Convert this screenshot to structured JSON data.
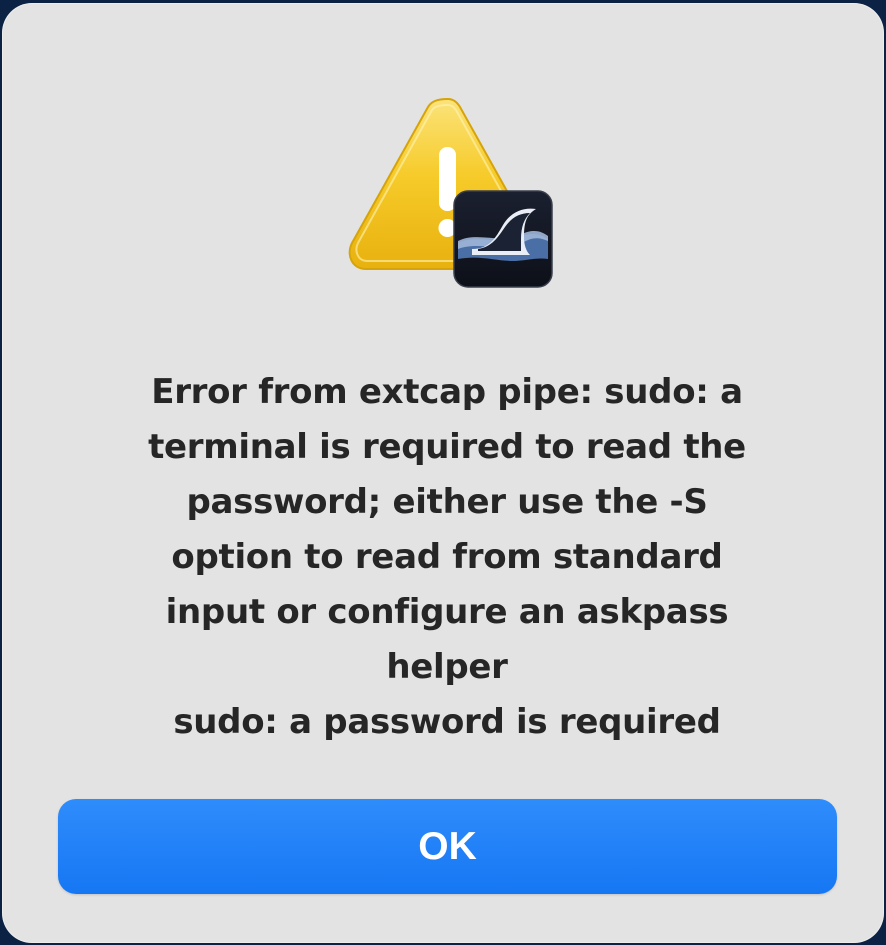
{
  "dialog": {
    "message_lines": [
      "Error from extcap pipe: sudo: a",
      "terminal is required to read the",
      "password; either use the -S",
      "option to read from standard",
      "input or configure an askpass",
      "helper",
      "sudo: a password is required"
    ],
    "ok_label": "OK"
  },
  "icons": {
    "alert": "warning-triangle-icon",
    "app_badge": "wireshark-fin-icon"
  },
  "colors": {
    "background": "#0c2244",
    "dialog": "#e3e3e3",
    "warning_yellow": "#f5c518",
    "button_blue": "#1a7cf6",
    "text": "#262626"
  }
}
